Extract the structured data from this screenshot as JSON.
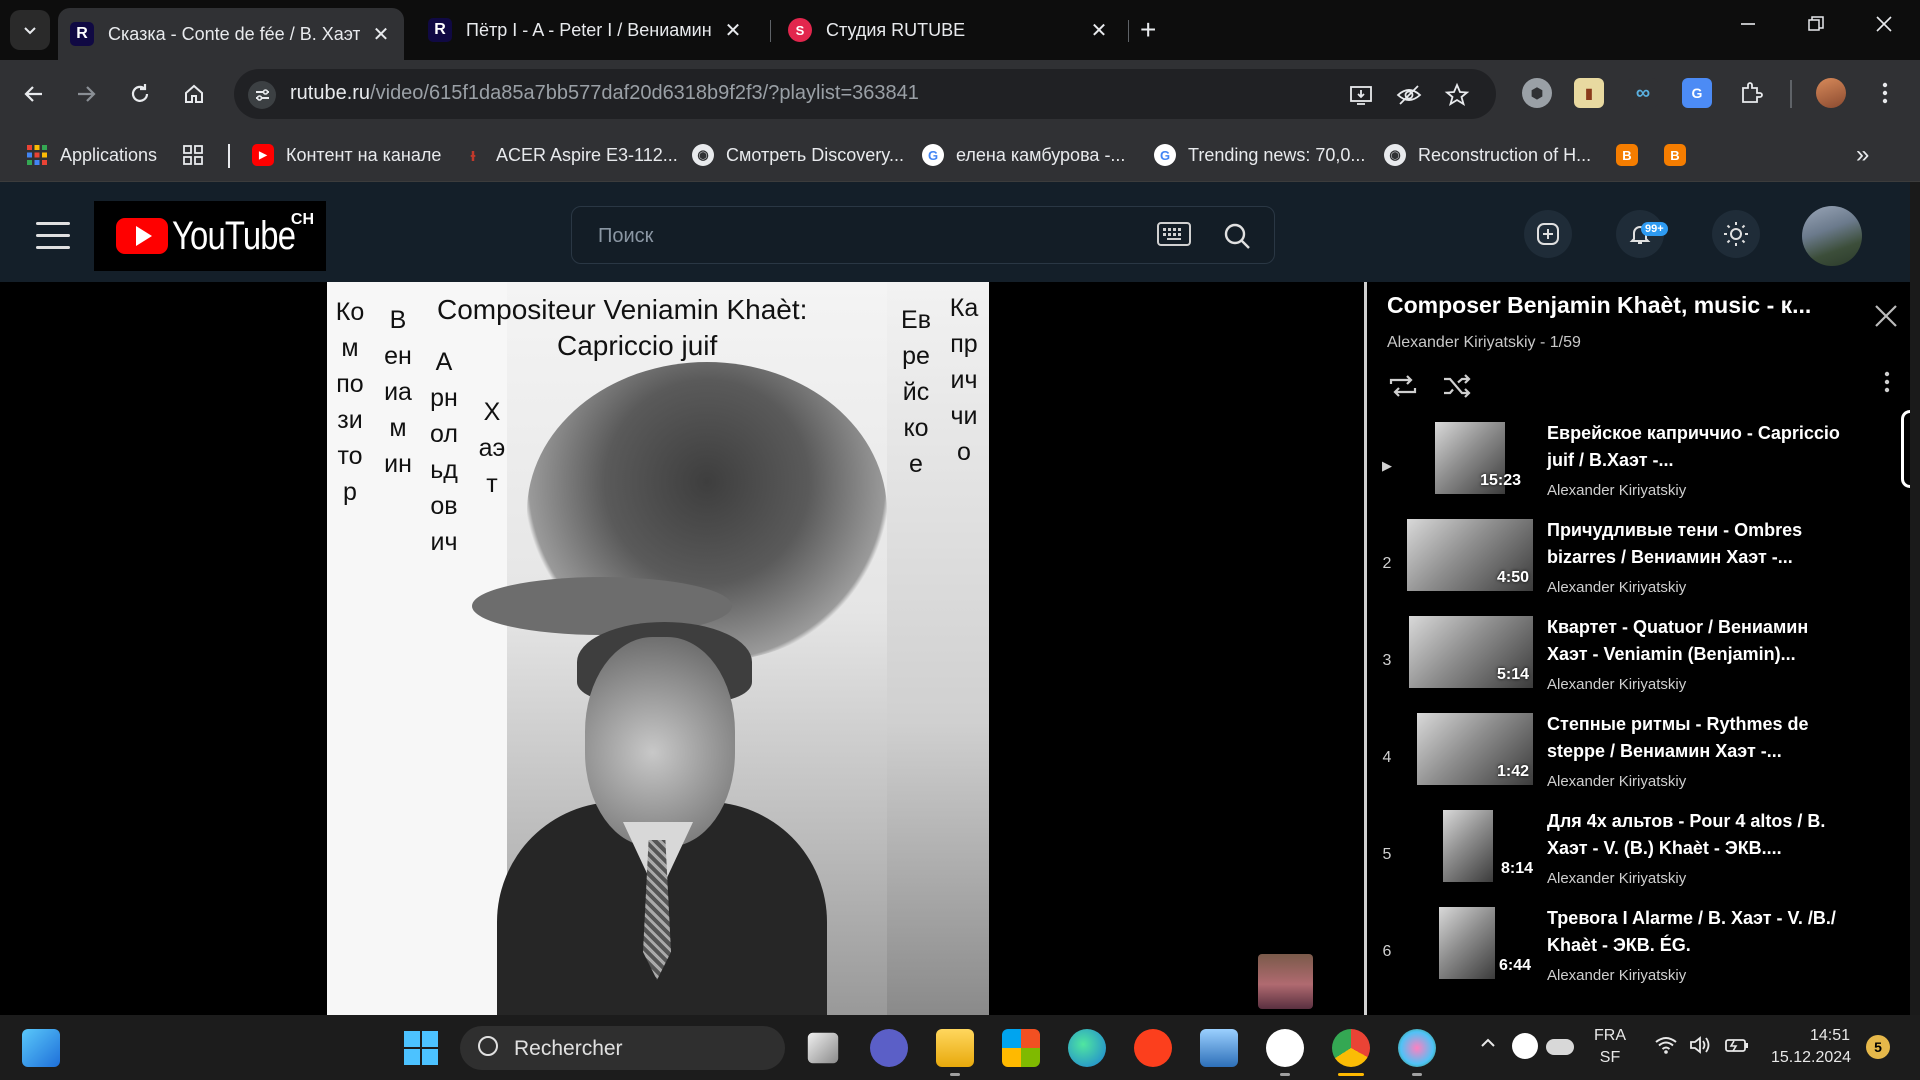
{
  "browser": {
    "tabs": [
      {
        "title": "Сказка - Conte de fée / В. Хаэт",
        "favicon_letter": "R",
        "active": true
      },
      {
        "title": "Пётр I - A - Peter I / Вениамин",
        "favicon_letter": "R",
        "active": false
      },
      {
        "title": "Студия RUTUBE",
        "favicon_letter": "S",
        "active": false
      }
    ],
    "tab_close_glyph": "✕",
    "new_tab_glyph": "+",
    "url_host": "rutube.ru",
    "url_path": "/video/615f1da85a7bb577daf20d6318b9f2f3/?playlist=363841",
    "bookmarks": [
      {
        "label": "Applications",
        "icon": "apps-grid-icon"
      },
      {
        "label": "Контент на канале",
        "icon": "youtube-icon"
      },
      {
        "label": "ACER Aspire E3-112...",
        "icon": "bookmark-favicon"
      },
      {
        "label": "Смотреть Discovery...",
        "icon": "globe-icon"
      },
      {
        "label": "елена камбурова -...",
        "icon": "google-icon"
      },
      {
        "label": "Trending news: 70,0...",
        "icon": "google-icon"
      },
      {
        "label": "Reconstruction of H...",
        "icon": "globe-icon"
      }
    ],
    "bookmarks_overflow": "»"
  },
  "site": {
    "logo_text": "YouTube",
    "logo_region": "CH",
    "search_placeholder": "Поиск",
    "notifications_badge": "99+"
  },
  "video": {
    "caption_line1": "Compositeur Veniamin Khaèt:",
    "caption_line2": "Capriccio juif",
    "vertical_texts": [
      "Композитор",
      "Вениамин",
      "Арнольдович",
      "Хаэт",
      "Еврейское",
      "Каприччио"
    ]
  },
  "playlist": {
    "title": "Composer Benjamin Khaèt, music - к...",
    "subtitle": "Alexander Kiriyatskiy - 1/59",
    "items": [
      {
        "index": "▶",
        "title": "Еврейское каприччио - Capriccio juif / В.Хаэт -...",
        "channel": "Alexander Kiriyatskiy",
        "duration": "15:23"
      },
      {
        "index": "2",
        "title": "Причудливые тени - Ombres bizarres / Вениамин Хаэт -...",
        "channel": "Alexander Kiriyatskiy",
        "duration": "4:50"
      },
      {
        "index": "3",
        "title": "Квартет - Quatuor / Вениамин Хаэт - Veniamin (Benjamin)...",
        "channel": "Alexander Kiriyatskiy",
        "duration": "5:14"
      },
      {
        "index": "4",
        "title": "Степные ритмы - Rythmes de steppe / Вениамин Хаэт -...",
        "channel": "Alexander Kiriyatskiy",
        "duration": "1:42"
      },
      {
        "index": "5",
        "title": "Для 4х альтов - Pour 4 altos / В. Хаэт - V. (B.) Khaèt - ЭКВ....",
        "channel": "Alexander Kiriyatskiy",
        "duration": "8:14"
      },
      {
        "index": "6",
        "title": "Тревога I Alarme / В. Хаэт - V. /B./ Khaèt - ЭКВ. ÉG.",
        "channel": "Alexander Kiriyatskiy",
        "duration": "6:44"
      }
    ]
  },
  "taskbar": {
    "search_placeholder": "Rechercher",
    "lang_line1": "FRA",
    "lang_line2": "SF",
    "time": "14:51",
    "date": "15.12.2024",
    "notification_count": "5"
  }
}
